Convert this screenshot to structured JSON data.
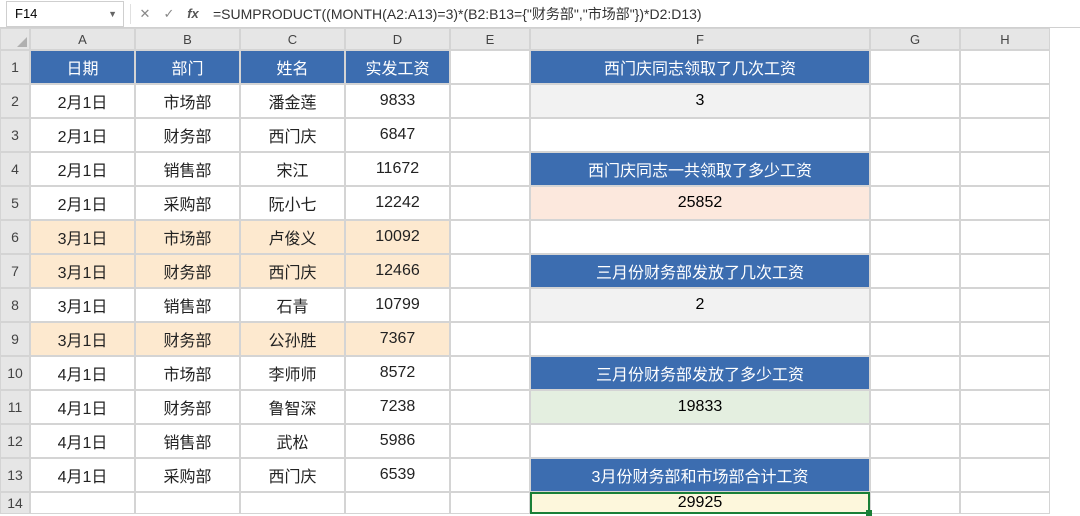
{
  "name_box": "F14",
  "formula": "=SUMPRODUCT((MONTH(A2:A13)=3)*(B2:B13={\"财务部\",\"市场部\"})*D2:D13)",
  "columns": [
    "A",
    "B",
    "C",
    "D",
    "E",
    "F",
    "G",
    "H"
  ],
  "rows": [
    "1",
    "2",
    "3",
    "4",
    "5",
    "6",
    "7",
    "8",
    "9",
    "10",
    "11",
    "12",
    "13",
    "14"
  ],
  "table_header": {
    "A": "日期",
    "B": "部门",
    "C": "姓名",
    "D": "实发工资"
  },
  "table": [
    {
      "date": "2月1日",
      "dept": "市场部",
      "name": "潘金莲",
      "salary": "9833",
      "hl": false
    },
    {
      "date": "2月1日",
      "dept": "财务部",
      "name": "西门庆",
      "salary": "6847",
      "hl": false
    },
    {
      "date": "2月1日",
      "dept": "销售部",
      "name": "宋江",
      "salary": "11672",
      "hl": false
    },
    {
      "date": "2月1日",
      "dept": "采购部",
      "name": "阮小七",
      "salary": "12242",
      "hl": false
    },
    {
      "date": "3月1日",
      "dept": "市场部",
      "name": "卢俊义",
      "salary": "10092",
      "hl": true
    },
    {
      "date": "3月1日",
      "dept": "财务部",
      "name": "西门庆",
      "salary": "12466",
      "hl": true
    },
    {
      "date": "3月1日",
      "dept": "销售部",
      "name": "石青",
      "salary": "10799",
      "hl": false
    },
    {
      "date": "3月1日",
      "dept": "财务部",
      "name": "公孙胜",
      "salary": "7367",
      "hl": true
    },
    {
      "date": "4月1日",
      "dept": "市场部",
      "name": "李师师",
      "salary": "8572",
      "hl": false
    },
    {
      "date": "4月1日",
      "dept": "财务部",
      "name": "鲁智深",
      "salary": "7238",
      "hl": false
    },
    {
      "date": "4月1日",
      "dept": "销售部",
      "name": "武松",
      "salary": "5986",
      "hl": false
    },
    {
      "date": "4月1日",
      "dept": "采购部",
      "name": "西门庆",
      "salary": "6539",
      "hl": false
    }
  ],
  "f_column": {
    "1": {
      "text": "西门庆同志领取了几次工资",
      "cls": "f-hdr"
    },
    "2": {
      "text": "3",
      "cls": "f-gray"
    },
    "4": {
      "text": "西门庆同志一共领取了多少工资",
      "cls": "f-hdr"
    },
    "5": {
      "text": "25852",
      "cls": "f-peach"
    },
    "7": {
      "text": "三月份财务部发放了几次工资",
      "cls": "f-hdr"
    },
    "8": {
      "text": "2",
      "cls": "f-gray"
    },
    "10": {
      "text": "三月份财务部发放了多少工资",
      "cls": "f-hdr"
    },
    "11": {
      "text": "19833",
      "cls": "f-green"
    },
    "13": {
      "text": "3月份财务部和市场部合计工资",
      "cls": "f-hdr"
    },
    "14": {
      "text": "29925",
      "cls": "f-yellow selected"
    }
  }
}
